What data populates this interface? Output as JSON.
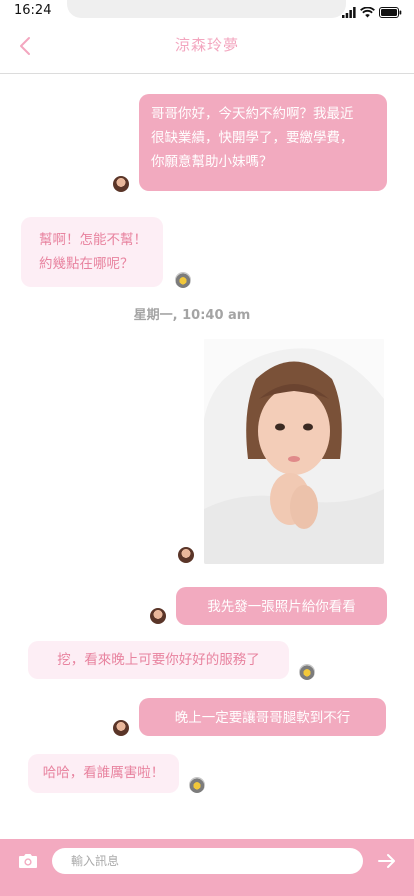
{
  "status_bar": {
    "time": "16:24",
    "icons": [
      "signal-icon",
      "wifi-icon",
      "battery-icon"
    ]
  },
  "header": {
    "title": "涼森玲夢",
    "back_icon": "chevron-left-icon",
    "accent_color": "#f3a6bf"
  },
  "messages": [
    {
      "direction": "sent",
      "lines": [
        "哥哥你好，今天約不約啊？我最近",
        "很缺業績，快開學了，要繳學費，",
        "你願意幫助小妹嗎？"
      ]
    },
    {
      "direction": "received",
      "lines": [
        "幫啊！怎能不幫！",
        "約幾點在哪呢？"
      ]
    },
    {
      "timestamp": "星期一, 10:40 am"
    },
    {
      "direction": "sent",
      "type": "image"
    },
    {
      "direction": "sent",
      "text": "我先發一張照片給你看看"
    },
    {
      "direction": "received",
      "text": "挖，看來晚上可要你好好的服務了"
    },
    {
      "direction": "sent",
      "text": "晚上一定要讓哥哥腿軟到不行"
    },
    {
      "direction": "received",
      "text": "哈哈，看誰厲害啦！"
    }
  ],
  "input_bar": {
    "placeholder": "輸入訊息",
    "camera_icon": "camera-icon",
    "send_icon": "send-arrow-icon",
    "background_color": "#f3aac0"
  },
  "colors": {
    "sent_bubble": "#f2aabf",
    "received_bubble": "#fdeef5",
    "received_text": "#e8839f"
  }
}
